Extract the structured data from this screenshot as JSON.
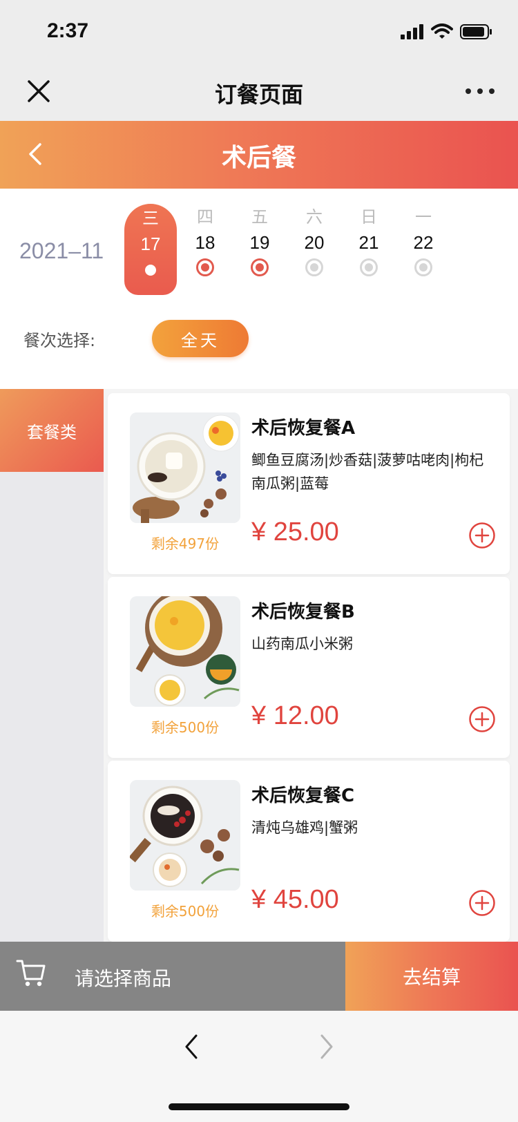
{
  "status_bar": {
    "time": "2:37"
  },
  "wechat_nav": {
    "title": "订餐页面"
  },
  "header": {
    "title": "术后餐"
  },
  "calendar": {
    "month": "2021–11",
    "days": [
      {
        "weekday": "三",
        "date": "17",
        "state": "selected"
      },
      {
        "weekday": "四",
        "date": "18",
        "state": "available"
      },
      {
        "weekday": "五",
        "date": "19",
        "state": "available"
      },
      {
        "weekday": "六",
        "date": "20",
        "state": "unavailable"
      },
      {
        "weekday": "日",
        "date": "21",
        "state": "unavailable"
      },
      {
        "weekday": "一",
        "date": "22",
        "state": "unavailable"
      }
    ]
  },
  "meal_selection": {
    "label": "餐次选择:",
    "option": "全天"
  },
  "categories": [
    {
      "label": "套餐类",
      "active": true
    }
  ],
  "products": [
    {
      "name": "术后恢复餐A",
      "description": "鲫鱼豆腐汤|炒香菇|菠萝咕咾肉|枸杞南瓜粥|蓝莓",
      "price": "¥ 25.00",
      "stock": "剩余497份"
    },
    {
      "name": "术后恢复餐B",
      "description": "山药南瓜小米粥",
      "price": "¥ 12.00",
      "stock": "剩余500份"
    },
    {
      "name": "术后恢复餐C",
      "description": "清炖乌雄鸡|蟹粥",
      "price": "¥ 45.00",
      "stock": "剩余500份"
    }
  ],
  "cart": {
    "label": "请选择商品",
    "checkout_label": "去结算"
  },
  "colors": {
    "accent_red": "#e0443e",
    "accent_orange": "#f2a23b",
    "gradient_start": "#f0a257",
    "gradient_end": "#ea5350"
  }
}
